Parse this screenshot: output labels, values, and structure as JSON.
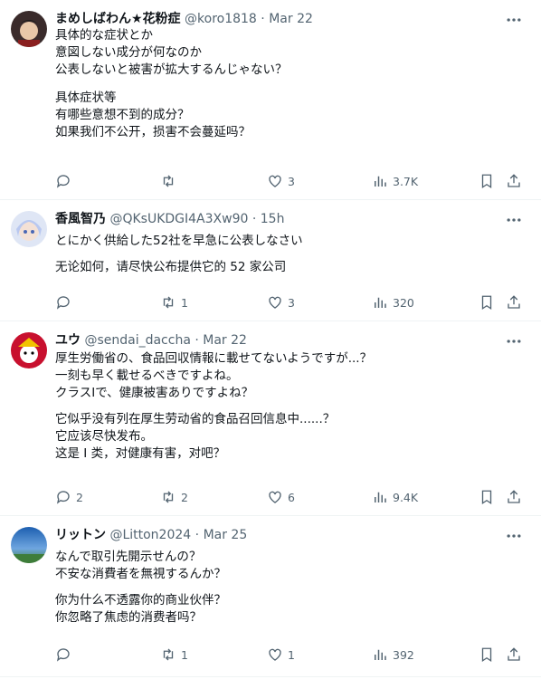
{
  "tweets": [
    {
      "name": "まめしばわん★花粉症",
      "handle": "@koro1818",
      "sep": "·",
      "time": "Mar 22",
      "text_ja": [
        "具体的な症状とか",
        "意図しない成分が何なのか",
        "公表しないと被害が拡大するんじゃない？"
      ],
      "text_zh": [
        "具体症状等",
        "有哪些意想不到的成分？",
        "如果我们不公开，损害不会蔓延吗？"
      ],
      "replies": "",
      "retweets": "",
      "likes": "3",
      "views": "3.7K"
    },
    {
      "name": "香風智乃",
      "handle": "@QKsUKDGI4A3Xw90",
      "sep": "·",
      "time": "15h",
      "text_ja": [
        "とにかく供給した52社を早急に公表しなさい"
      ],
      "text_zh": [
        "无论如何，请尽快公布提供它的 52 家公司"
      ],
      "replies": "",
      "retweets": "1",
      "likes": "3",
      "views": "320"
    },
    {
      "name": "ユウ",
      "handle": "@sendai_daccha",
      "sep": "·",
      "time": "Mar 22",
      "text_ja": [
        "厚生労働省の、食品回収情報に載せてないようですが...？",
        "一刻も早く載せるべきですよね。",
        "クラスⅠで、健康被害ありですよね？"
      ],
      "text_zh": [
        "它似乎没有列在厚生劳动省的食品召回信息中......？",
        "它应该尽快发布。",
        "这是 I 类，对健康有害，对吧？"
      ],
      "replies": "2",
      "retweets": "2",
      "likes": "6",
      "views": "9.4K"
    },
    {
      "name": "リットン",
      "handle": "@Litton2024",
      "sep": "·",
      "time": "Mar 25",
      "text_ja": [
        "なんで取引先開示せんの？",
        "不安な消費者を無視するんか？"
      ],
      "text_zh": [
        "你为什么不透露你的商业伙伴？",
        "你忽略了焦虑的消费者吗？"
      ],
      "replies": "",
      "retweets": "1",
      "likes": "1",
      "views": "392"
    }
  ],
  "icons": {
    "more": "more-horizontal-icon",
    "reply": "reply-bubble-icon",
    "retweet": "retweet-icon",
    "like": "heart-icon",
    "views": "bar-chart-icon",
    "bookmark": "bookmark-icon",
    "share": "share-upload-icon"
  },
  "colors": {
    "text": "#0f1419",
    "muted": "#536471",
    "divider": "#eff3f4"
  }
}
